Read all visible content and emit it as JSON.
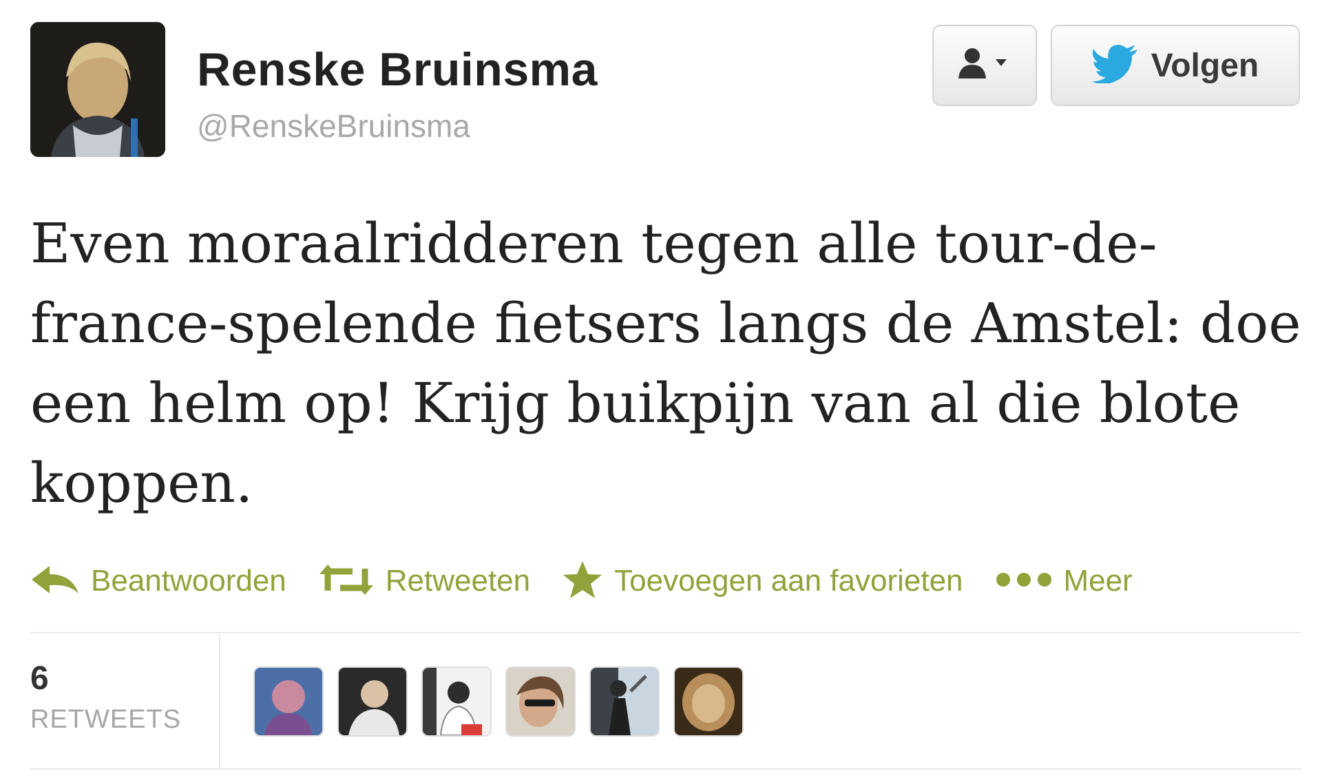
{
  "profile": {
    "name": "Renske Bruinsma",
    "handle": "@RenskeBruinsma"
  },
  "header_buttons": {
    "user_menu_icon": "person-dropdown-icon",
    "follow_label": "Volgen",
    "follow_icon": "twitter-bird-icon"
  },
  "tweet": {
    "text": "Even moraalridderen tegen alle tour-de-france-spelende fietsers langs de Amstel: doe een helm op! Krijg buikpijn van al die blote koppen."
  },
  "actions": [
    {
      "label": "Beantwoorden",
      "icon": "reply-arrow-icon"
    },
    {
      "label": "Retweeten",
      "icon": "retweet-icon"
    },
    {
      "label": "Toevoegen aan favorieten",
      "icon": "star-icon"
    },
    {
      "label": "Meer",
      "icon": "more-dots-icon"
    }
  ],
  "stats": {
    "retweet_count": "6",
    "retweet_label": "RETWEETS"
  },
  "colors": {
    "action_green": "#8fa33a",
    "twitter_blue": "#2aa9e0",
    "handle_gray": "#a8a8a8"
  }
}
